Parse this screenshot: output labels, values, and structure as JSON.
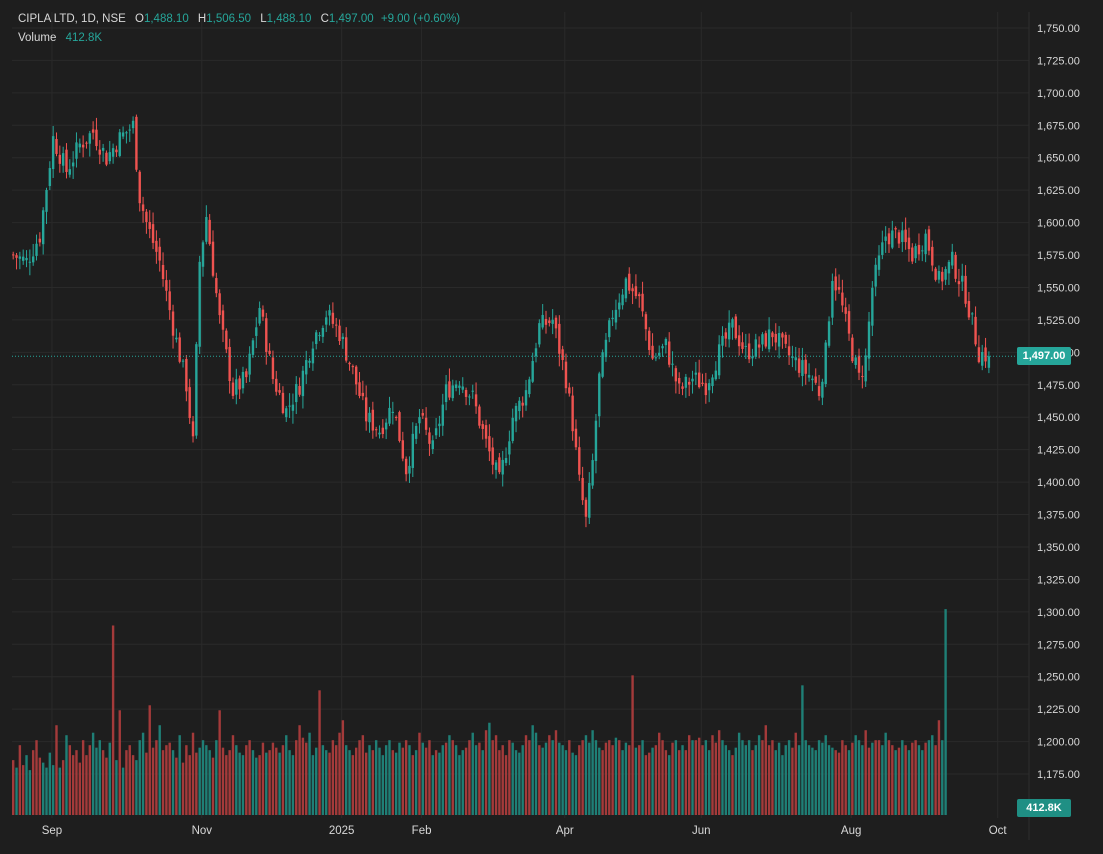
{
  "legend": {
    "symbol": "CIPLA LTD, 1D, NSE",
    "open_key": "O",
    "open": "1,488.10",
    "high_key": "H",
    "high": "1,506.50",
    "low_key": "L",
    "low": "1,488.10",
    "close_key": "C",
    "close": "1,497.00",
    "change": "+9.00 (+0.60%)",
    "volume_label": "Volume",
    "volume_value": "412.8K"
  },
  "tags": {
    "last_price": "1,497.00",
    "last_volume": "412.8K"
  },
  "colors": {
    "up": "#26a69a",
    "down": "#ef5350",
    "up_volume": "#1f7f76",
    "down_volume": "#a43a3a",
    "grid": "#2a2a2a",
    "text": "#d8d8d8"
  },
  "chart_data": {
    "type": "candlestick",
    "title": "CIPLA LTD, 1D, NSE",
    "ylim": [
      1312.5,
      1762.5
    ],
    "yticks": [
      "1,750.00",
      "1,725.00",
      "1,700.00",
      "1,675.00",
      "1,650.00",
      "1,625.00",
      "1,600.00",
      "1,575.00",
      "1,550.00",
      "1,525.00",
      "1,500.00",
      "1,475.00",
      "1,450.00",
      "1,425.00",
      "1,400.00",
      "1,375.00",
      "1,350.00",
      "1,325.00",
      "1,300.00",
      "1,275.00",
      "1,250.00",
      "1,225.00",
      "1,200.00",
      "1,175.00"
    ],
    "xticks": [
      "Sep",
      "Nov",
      "2025",
      "Feb",
      "Apr",
      "Jun",
      "Aug",
      "Oct"
    ],
    "last_close": 1497.0,
    "close_path": [
      {
        "x": 0,
        "y": 1575
      },
      {
        "x": 4,
        "y": 1570
      },
      {
        "x": 8,
        "y": 1590
      },
      {
        "x": 12,
        "y": 1665
      },
      {
        "x": 16,
        "y": 1640
      },
      {
        "x": 20,
        "y": 1660
      },
      {
        "x": 24,
        "y": 1670
      },
      {
        "x": 28,
        "y": 1650
      },
      {
        "x": 32,
        "y": 1665
      },
      {
        "x": 36,
        "y": 1675
      },
      {
        "x": 38,
        "y": 1620
      },
      {
        "x": 40,
        "y": 1600
      },
      {
        "x": 44,
        "y": 1570
      },
      {
        "x": 48,
        "y": 1520
      },
      {
        "x": 52,
        "y": 1475
      },
      {
        "x": 54,
        "y": 1430
      },
      {
        "x": 56,
        "y": 1570
      },
      {
        "x": 58,
        "y": 1605
      },
      {
        "x": 62,
        "y": 1525
      },
      {
        "x": 66,
        "y": 1470
      },
      {
        "x": 70,
        "y": 1480
      },
      {
        "x": 74,
        "y": 1535
      },
      {
        "x": 78,
        "y": 1480
      },
      {
        "x": 82,
        "y": 1455
      },
      {
        "x": 86,
        "y": 1475
      },
      {
        "x": 90,
        "y": 1510
      },
      {
        "x": 94,
        "y": 1530
      },
      {
        "x": 98,
        "y": 1515
      },
      {
        "x": 102,
        "y": 1485
      },
      {
        "x": 106,
        "y": 1450
      },
      {
        "x": 110,
        "y": 1440
      },
      {
        "x": 114,
        "y": 1460
      },
      {
        "x": 118,
        "y": 1410
      },
      {
        "x": 122,
        "y": 1450
      },
      {
        "x": 126,
        "y": 1425
      },
      {
        "x": 130,
        "y": 1470
      },
      {
        "x": 134,
        "y": 1480
      },
      {
        "x": 138,
        "y": 1465
      },
      {
        "x": 142,
        "y": 1430
      },
      {
        "x": 146,
        "y": 1400
      },
      {
        "x": 150,
        "y": 1450
      },
      {
        "x": 154,
        "y": 1470
      },
      {
        "x": 158,
        "y": 1520
      },
      {
        "x": 162,
        "y": 1525
      },
      {
        "x": 166,
        "y": 1480
      },
      {
        "x": 168,
        "y": 1445
      },
      {
        "x": 170,
        "y": 1400
      },
      {
        "x": 172,
        "y": 1370
      },
      {
        "x": 174,
        "y": 1415
      },
      {
        "x": 176,
        "y": 1480
      },
      {
        "x": 180,
        "y": 1530
      },
      {
        "x": 184,
        "y": 1555
      },
      {
        "x": 188,
        "y": 1540
      },
      {
        "x": 192,
        "y": 1495
      },
      {
        "x": 196,
        "y": 1505
      },
      {
        "x": 200,
        "y": 1470
      },
      {
        "x": 204,
        "y": 1480
      },
      {
        "x": 208,
        "y": 1475
      },
      {
        "x": 212,
        "y": 1500
      },
      {
        "x": 216,
        "y": 1520
      },
      {
        "x": 220,
        "y": 1500
      },
      {
        "x": 224,
        "y": 1505
      },
      {
        "x": 228,
        "y": 1515
      },
      {
        "x": 232,
        "y": 1500
      },
      {
        "x": 236,
        "y": 1490
      },
      {
        "x": 240,
        "y": 1480
      },
      {
        "x": 242,
        "y": 1470
      },
      {
        "x": 244,
        "y": 1500
      },
      {
        "x": 246,
        "y": 1560
      },
      {
        "x": 248,
        "y": 1545
      },
      {
        "x": 252,
        "y": 1500
      },
      {
        "x": 254,
        "y": 1480
      },
      {
        "x": 256,
        "y": 1495
      },
      {
        "x": 258,
        "y": 1550
      },
      {
        "x": 262,
        "y": 1590
      },
      {
        "x": 266,
        "y": 1590
      },
      {
        "x": 270,
        "y": 1575
      },
      {
        "x": 274,
        "y": 1590
      },
      {
        "x": 278,
        "y": 1555
      },
      {
        "x": 282,
        "y": 1570
      },
      {
        "x": 286,
        "y": 1545
      },
      {
        "x": 290,
        "y": 1500
      },
      {
        "x": 293,
        "y": 1497
      }
    ],
    "volume_k": [
      110,
      95,
      140,
      100,
      120,
      90,
      130,
      150,
      115,
      105,
      95,
      125,
      100,
      180,
      95,
      110,
      160,
      140,
      120,
      130,
      105,
      150,
      120,
      140,
      165,
      135,
      150,
      130,
      115,
      145,
      380,
      110,
      210,
      95,
      130,
      140,
      120,
      110,
      150,
      165,
      125,
      220,
      135,
      150,
      180,
      130,
      140,
      145,
      130,
      115,
      160,
      105,
      140,
      120,
      165,
      125,
      135,
      150,
      140,
      130,
      115,
      150,
      210,
      135,
      120,
      130,
      160,
      140,
      125,
      120,
      140,
      150,
      130,
      115,
      120,
      145,
      125,
      130,
      145,
      135,
      125,
      140,
      160,
      130,
      120,
      150,
      180,
      155,
      145,
      165,
      120,
      135,
      250,
      140,
      130,
      125,
      150,
      140,
      165,
      190,
      140,
      130,
      120,
      135,
      150,
      160,
      125,
      140,
      130,
      150,
      135,
      120,
      140,
      150,
      130,
      125,
      145,
      135,
      150,
      140,
      120,
      130,
      165,
      145,
      135,
      150,
      120,
      130,
      125,
      140,
      145,
      160,
      150,
      140,
      120,
      130,
      135,
      150,
      165,
      140,
      145,
      130,
      170,
      185,
      150,
      160,
      130,
      140,
      120,
      150,
      145,
      130,
      125,
      140,
      160,
      150,
      180,
      165,
      140,
      135,
      145,
      160,
      150,
      170,
      145,
      140,
      130,
      150,
      125,
      120,
      140,
      150,
      160,
      145,
      170,
      150,
      135,
      130,
      145,
      150,
      140,
      155,
      150,
      130,
      145,
      140,
      280,
      135,
      140,
      150,
      120,
      125,
      135,
      140,
      165,
      150,
      130,
      120,
      145,
      150,
      130,
      140,
      130,
      160,
      150,
      150,
      155,
      140,
      150,
      130,
      160,
      145,
      170,
      150,
      140,
      130,
      120,
      135,
      165,
      150,
      140,
      150,
      130,
      140,
      160,
      150,
      180,
      140,
      150,
      130,
      145,
      120,
      140,
      150,
      135,
      165,
      140,
      260,
      150,
      140,
      135,
      130,
      150,
      145,
      160,
      140,
      135,
      130,
      125,
      150,
      140,
      130,
      145,
      160,
      150,
      140,
      170,
      135,
      145,
      150,
      150,
      140,
      165,
      150,
      140,
      130,
      135,
      150,
      140,
      130,
      145,
      150,
      140,
      130,
      145,
      150,
      160,
      140,
      190,
      150,
      412.8
    ]
  }
}
